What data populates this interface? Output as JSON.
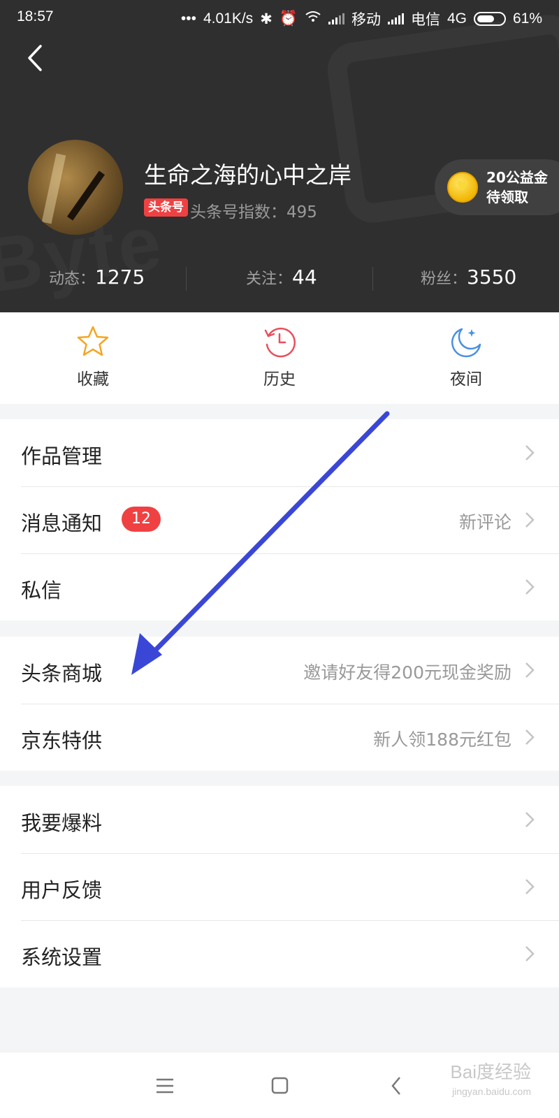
{
  "status_bar": {
    "time": "18:57",
    "dots": "•••",
    "speed": "4.01K/s",
    "carrier1": "移动",
    "carrier2": "电信",
    "network": "4G",
    "battery": "61%"
  },
  "profile": {
    "username": "生命之海的心中之岸",
    "tag": "头条号",
    "index": "头条号指数：495",
    "coin_line1": "20公益金",
    "coin_line2": "待领取"
  },
  "stats": [
    {
      "label": "动态：",
      "value": "1275"
    },
    {
      "label": "关注：",
      "value": "44"
    },
    {
      "label": "粉丝：",
      "value": "3550"
    }
  ],
  "quick": [
    {
      "label": "收藏",
      "icon": "star-icon"
    },
    {
      "label": "历史",
      "icon": "history-icon"
    },
    {
      "label": "夜间",
      "icon": "moon-icon"
    }
  ],
  "menu": {
    "group1": [
      {
        "label": "作品管理",
        "value": ""
      },
      {
        "label": "消息通知",
        "badge": "12",
        "value": "新评论"
      },
      {
        "label": "私信",
        "value": ""
      }
    ],
    "group2": [
      {
        "label": "头条商城",
        "value": "邀请好友得200元现金奖励"
      },
      {
        "label": "京东特供",
        "value": "新人领188元红包"
      }
    ],
    "group3": [
      {
        "label": "我要爆料",
        "value": ""
      },
      {
        "label": "用户反馈",
        "value": ""
      },
      {
        "label": "系统设置",
        "value": ""
      }
    ]
  },
  "watermark": {
    "brand": "Bai度经验",
    "url": "jingyan.baidu.com"
  },
  "colors": {
    "header_bg": "#2f2f2f",
    "accent_red": "#f04142",
    "arrow_blue": "#3a47d6",
    "star_orange": "#f5a623",
    "history_red": "#e8505b",
    "moon_blue": "#4a90e2"
  }
}
